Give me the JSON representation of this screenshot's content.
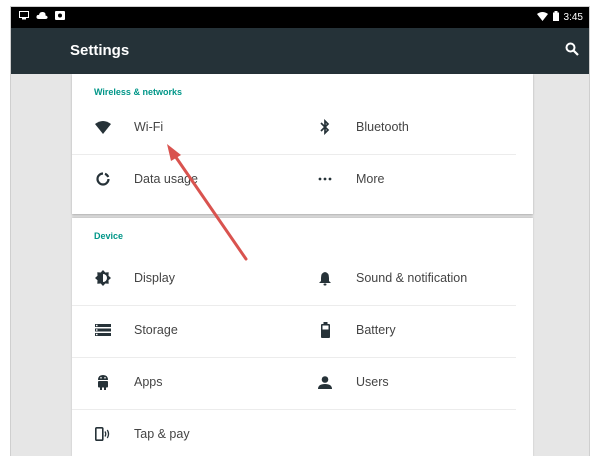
{
  "status_bar": {
    "time": "3:45",
    "left_icons": [
      "screen-icon",
      "cloud-upload-icon",
      "photo-icon"
    ],
    "right_icons": [
      "wifi-icon",
      "battery-icon"
    ]
  },
  "app_bar": {
    "title": "Settings",
    "search_icon": "search-icon"
  },
  "sections": [
    {
      "header": "Wireless & networks",
      "items": [
        {
          "label": "Wi-Fi",
          "icon": "wifi-icon"
        },
        {
          "label": "Bluetooth",
          "icon": "bluetooth-icon"
        },
        {
          "label": "Data usage",
          "icon": "data-usage-icon"
        },
        {
          "label": "More",
          "icon": "more-dots-icon"
        }
      ]
    },
    {
      "header": "Device",
      "items": [
        {
          "label": "Display",
          "icon": "display-icon"
        },
        {
          "label": "Sound & notification",
          "icon": "bell-icon"
        },
        {
          "label": "Storage",
          "icon": "storage-icon"
        },
        {
          "label": "Battery",
          "icon": "battery-icon"
        },
        {
          "label": "Apps",
          "icon": "android-icon"
        },
        {
          "label": "Users",
          "icon": "user-icon"
        },
        {
          "label": "Tap & pay",
          "icon": "tap-pay-icon"
        }
      ]
    }
  ],
  "colors": {
    "app_bar": "#253238",
    "accent": "#009688",
    "icon": "#263238",
    "annotation_arrow": "#d9534f"
  }
}
